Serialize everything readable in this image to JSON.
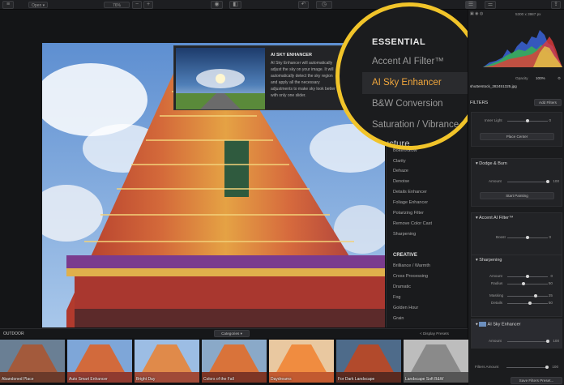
{
  "toolbar": {
    "open_label": "Open",
    "zoom_value": "76%",
    "zoom_minus": "−",
    "zoom_plus": "+",
    "right_readout": "5300 x 3987 px"
  },
  "tooltip": {
    "title": "AI SKY ENHANCER",
    "body": "AI Sky Enhancer will automatically adjust the sky on your image. It will automatically detect the sky region and apply all the necessary adjustments to make sky look better with only one slider."
  },
  "magnifier": {
    "heading": "ESSENTIAL",
    "items": [
      "Accent AI Filter™",
      "AI Sky Enhancer",
      "B&W Conversion",
      "Saturation / Vibrance"
    ],
    "subheading": "Structure"
  },
  "filter_menu": {
    "items_top": [
      "Bokeh/Glow",
      "Clarity",
      "Dehaze",
      "Denoise",
      "Details Enhancer",
      "Foliage Enhancer",
      "Polarizing Filter",
      "Remove Color Cast",
      "Sharpening"
    ],
    "creative_heading": "CREATIVE",
    "items_creative": [
      "Brilliance / Warmth",
      "Cross Processing",
      "Dramatic",
      "Fog",
      "Golden Hour",
      "Grain"
    ]
  },
  "right_panel": {
    "file_name": "shutterstock_282451325.jpg",
    "opacity_label": "Opacity",
    "opacity_value": "100%",
    "filters_label": "FILTERS",
    "add_filters": "Add Filters",
    "vignette": {
      "label": "Inner Light",
      "value": "0",
      "value_fraction": 0.5,
      "button": "Place Center"
    },
    "dodge_burn": {
      "title": "Dodge & Burn",
      "amount_label": "Amount",
      "amount_value": "100",
      "amount_fraction": 1.0,
      "button": "Start Painting"
    },
    "accent_ai": {
      "title": "Accent AI Filter™",
      "boost_label": "Boost",
      "boost_value": "0",
      "boost_fraction": 0.5
    },
    "sharpening": {
      "title": "Sharpening",
      "rows": [
        {
          "label": "Amount",
          "value": "0",
          "fraction": 0.5
        },
        {
          "label": "Radius",
          "value": "50",
          "fraction": 0.4
        },
        {
          "label": "Masking",
          "value": "25",
          "fraction": 0.7
        },
        {
          "label": "Details",
          "value": "50",
          "fraction": 0.55
        }
      ]
    },
    "sky": {
      "title": "AI Sky Enhancer",
      "amount_label": "Amount",
      "amount_value": "100",
      "amount_fraction": 1.0
    },
    "filters_amount_label": "Filters Amount",
    "filters_amount_value": "100",
    "filters_amount_fraction": 1.0,
    "save_preset": "Save Filters Preset..."
  },
  "looks": {
    "category": "OUTDOOR",
    "categories_label": "Categories",
    "display_presets": "< Display Presets",
    "items": [
      "Abandoned Place",
      "Auto Smart Enhancer",
      "Bright Day",
      "Colors of the Fall",
      "Daydreams",
      "For Dark Landscape",
      "Landscape Soft B&W"
    ]
  }
}
